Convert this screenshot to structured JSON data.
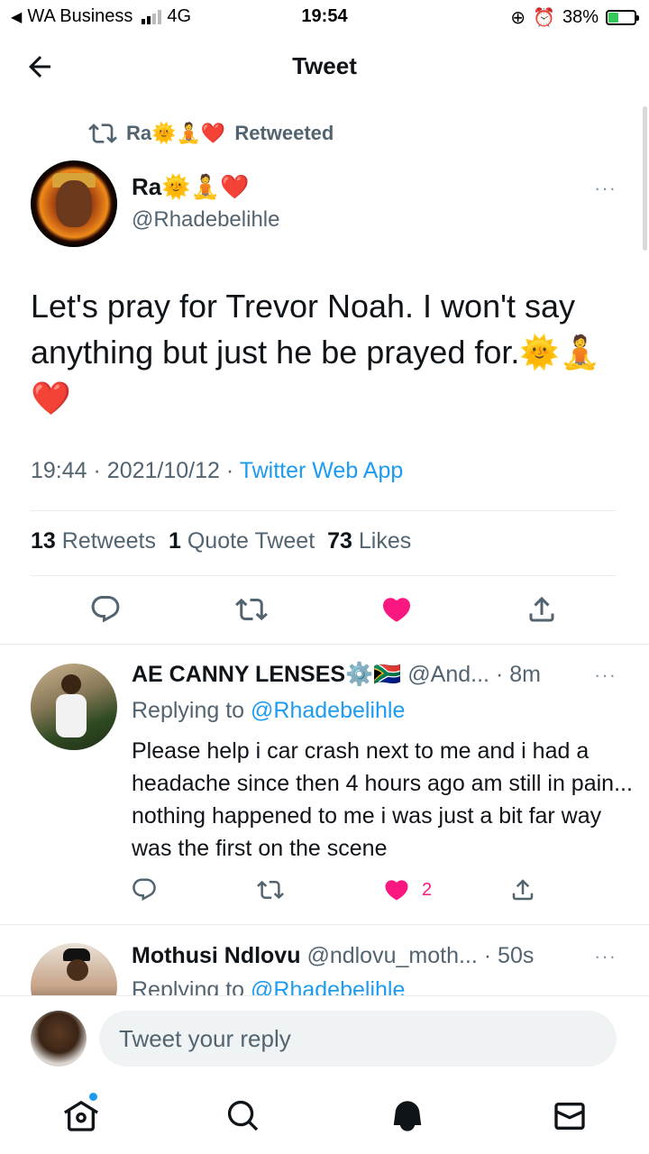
{
  "status_bar": {
    "carrier": "WA Business",
    "network": "4G",
    "time": "19:54",
    "battery": "38%",
    "battery_level": 0.38
  },
  "header": {
    "title": "Tweet"
  },
  "retweet": {
    "name": "Ra🌞🧘❤️",
    "label": "Retweeted"
  },
  "tweet": {
    "author_name": "Ra🌞🧘❤️",
    "author_handle": "@Rhadebelihle",
    "text": "Let's pray for Trevor Noah. I won't say anything but just he be prayed for.🌞🧘❤️",
    "time": "19:44",
    "date": "2021/10/12",
    "separator": "·",
    "source": "Twitter Web App",
    "more": "···"
  },
  "stats": {
    "retweets_count": "13",
    "retweets_label": "Retweets",
    "quotes_count": "1",
    "quotes_label": "Quote Tweet",
    "likes_count": "73",
    "likes_label": "Likes"
  },
  "replies": [
    {
      "name": "AE CANNY LENSES⚙️🇿🇦",
      "handle": "@And...",
      "time": "· 8m",
      "replying_prefix": "Replying to",
      "replying_handle": "@Rhadebelihle",
      "text": "Please help i car crash next to me and i had a headache since then 4 hours ago am still in pain... nothing happened to me i was just a bit far way was the first on the scene",
      "like_count": "2",
      "more": "···"
    },
    {
      "name": "Mothusi Ndlovu",
      "handle": "@ndlovu_moth...",
      "time": "· 50s",
      "replying_prefix": "Replying to",
      "replying_handle": "@Rhadebelihle",
      "more": "···"
    }
  ],
  "composer": {
    "placeholder": "Tweet your reply"
  },
  "colors": {
    "accent": "#1d9bf0",
    "like": "#f91880",
    "muted": "#536471"
  },
  "icons": [
    "back-arrow-icon",
    "retweet-icon",
    "reply-icon",
    "like-icon",
    "share-icon",
    "home-icon",
    "search-icon",
    "notifications-icon",
    "messages-icon"
  ]
}
